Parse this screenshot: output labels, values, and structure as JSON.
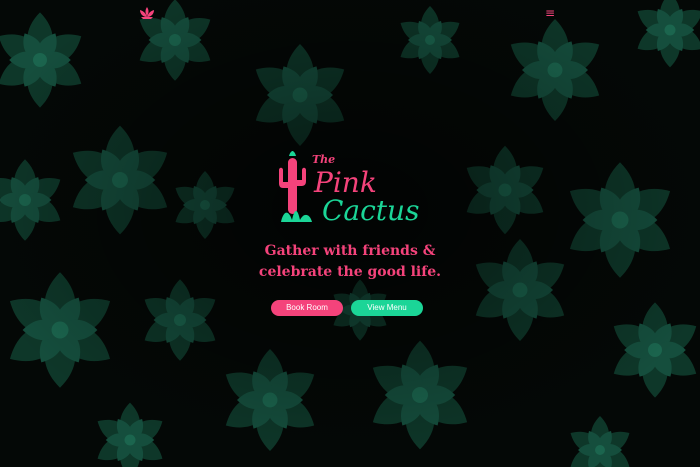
{
  "brand": {
    "name_the": "The",
    "name_pink": "Pink",
    "name_cactus": "Cactus",
    "pink_color": "#f4437b",
    "green_color": "#1bd597"
  },
  "nav": {
    "logo_icon": "lotus-icon",
    "menu_icon": "hamburger-menu-icon",
    "menu_glyph": "≡"
  },
  "hero": {
    "tagline_line1": "Gather with friends &",
    "tagline_line2": "celebrate the good life.",
    "background": "succulent-photo-dark"
  },
  "buttons": {
    "book_label": "Book Room",
    "menu_label": "View Menu"
  }
}
